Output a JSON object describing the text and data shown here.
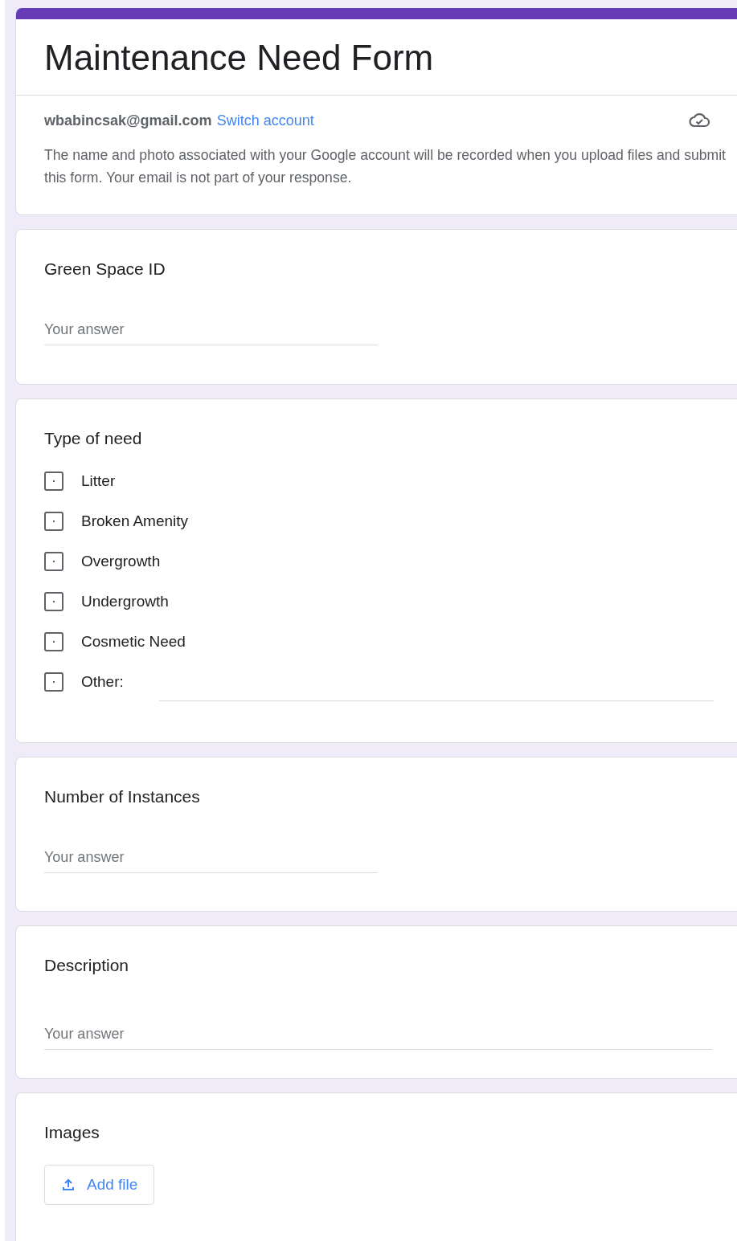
{
  "form": {
    "title": "Maintenance Need Form",
    "account_email": "wbabincsak@gmail.com",
    "switch_account": "Switch account",
    "notice": "The name and photo associated with your Google account will be recorded when you upload files and submit this form. Your email is not part of your response."
  },
  "questions": [
    {
      "kind": "short",
      "title": "Green Space ID",
      "placeholder": "Your answer"
    },
    {
      "kind": "checkboxes",
      "title": "Type of need",
      "options": [
        {
          "label": "Litter",
          "checked": false
        },
        {
          "label": "Broken Amenity",
          "checked": false
        },
        {
          "label": "Overgrowth",
          "checked": false
        },
        {
          "label": "Undergrowth",
          "checked": false
        },
        {
          "label": "Cosmetic Need",
          "checked": false
        },
        {
          "label": "Other:",
          "checked": false,
          "kind": "other"
        }
      ]
    },
    {
      "kind": "short",
      "title": "Number of Instances",
      "placeholder": "Your answer"
    },
    {
      "kind": "paragraph",
      "title": "Description",
      "placeholder": "Your answer"
    },
    {
      "kind": "file",
      "title": "Images",
      "button": "Add file"
    }
  ]
}
